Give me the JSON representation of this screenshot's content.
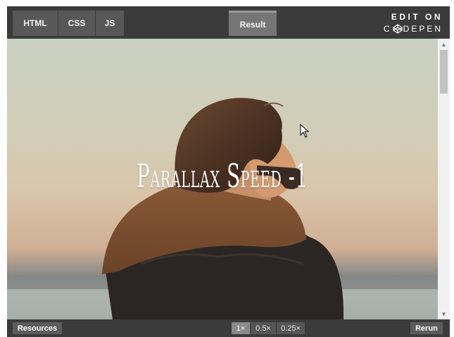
{
  "topbar": {
    "tabs": [
      "HTML",
      "CSS",
      "JS"
    ],
    "result_label": "Result",
    "edit_on_label": "EDIT ON",
    "codepen_left": "C",
    "codepen_right": "DEPEN"
  },
  "preview": {
    "title": "Parallax Speed -1"
  },
  "bottombar": {
    "resources_label": "Resources",
    "zoom_options": [
      "1×",
      "0.5×",
      "0.25×"
    ],
    "zoom_selected": "1×",
    "rerun_label": "Rerun"
  },
  "icons": {
    "codepen": "codepen-logo-icon",
    "scroll_up": "scroll-up-arrow-icon",
    "scroll_down": "scroll-down-arrow-icon",
    "cursor": "mouse-pointer-icon"
  },
  "colors": {
    "chrome_dark": "#3b3b3b",
    "tab_bg": "#585858",
    "active_tab_bg": "#767676",
    "title_text": "#ffffff"
  }
}
